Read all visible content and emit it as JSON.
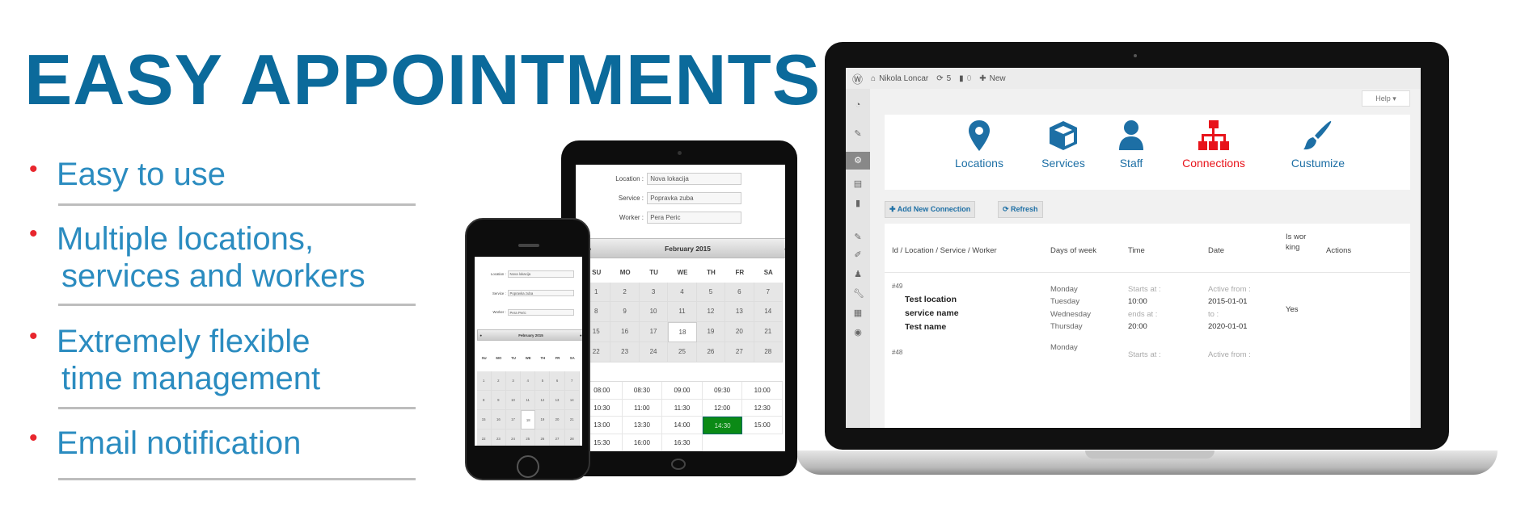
{
  "headline": "EASY APPOINTMENTS",
  "features": [
    {
      "lines": [
        "Easy to use"
      ]
    },
    {
      "lines": [
        "Multiple locations,",
        "services and workers"
      ]
    },
    {
      "lines": [
        "Extremely flexible",
        "time management"
      ]
    },
    {
      "lines": [
        "Email notification"
      ]
    }
  ],
  "colors": {
    "title": "#0b6a9b",
    "feature_text": "#2b8cc0",
    "bullet": "#e8262d",
    "nav_blue": "#1d6fa5",
    "nav_active": "#e8141b",
    "selected_time": "#0b8a16"
  },
  "admin": {
    "admin_bar": {
      "user": "Nikola Loncar",
      "updates": "5",
      "comments": "0",
      "new": "New"
    },
    "help": "Help ▾",
    "nav": [
      {
        "label": "Locations",
        "icon": "map-pin-icon",
        "active": false
      },
      {
        "label": "Services",
        "icon": "cube-icon",
        "active": false
      },
      {
        "label": "Staff",
        "icon": "user-icon",
        "active": false
      },
      {
        "label": "Connections",
        "icon": "sitemap-icon",
        "active": true
      },
      {
        "label": "Custumize",
        "icon": "paintbrush-icon",
        "active": false
      }
    ],
    "add_button": "✚ Add New Connection",
    "refresh_button": "⟳ Refresh",
    "table": {
      "headers": [
        "Id / Location / Service / Worker",
        "Days of week",
        "Time",
        "Date",
        "Is working",
        "Actions"
      ],
      "rows": [
        {
          "id": "#49",
          "location": "Test location",
          "service": "service name",
          "worker": "Test name",
          "days": [
            "Monday",
            "Tuesday",
            "Wednesday",
            "Thursday"
          ],
          "starts_label": "Starts at :",
          "starts": "10:00",
          "ends_label": "ends at :",
          "ends": "20:00",
          "from_label": "Active from :",
          "from": "2015-01-01",
          "to_label": "to :",
          "to": "2020-01-01",
          "working": "Yes"
        },
        {
          "id": "#48",
          "days": [
            "Monday"
          ],
          "starts_label": "Starts at :",
          "from_label": "Active from :"
        }
      ]
    }
  },
  "booking": {
    "fields": [
      {
        "label": "Location :",
        "value": "Nova lokacija"
      },
      {
        "label": "Service :",
        "value": "Popravka zuba"
      },
      {
        "label": "Worker :",
        "value": "Pera Peric"
      }
    ],
    "month": "February 2015",
    "day_names": [
      "SU",
      "MO",
      "TU",
      "WE",
      "TH",
      "FR",
      "SA"
    ],
    "dates": [
      "1",
      "2",
      "3",
      "4",
      "5",
      "6",
      "7",
      "8",
      "9",
      "10",
      "11",
      "12",
      "13",
      "14",
      "15",
      "16",
      "17",
      "18",
      "19",
      "20",
      "21",
      "22",
      "23",
      "24",
      "25",
      "26",
      "27",
      "28"
    ],
    "selected_date": "18",
    "times": [
      "08:00",
      "08:30",
      "09:00",
      "09:30",
      "10:00",
      "10:30",
      "11:00",
      "11:30",
      "12:00",
      "12:30",
      "13:00",
      "13:30",
      "14:00",
      "14:30",
      "15:00",
      "15:30",
      "16:00",
      "16:30"
    ],
    "selected_time": "14:30"
  }
}
